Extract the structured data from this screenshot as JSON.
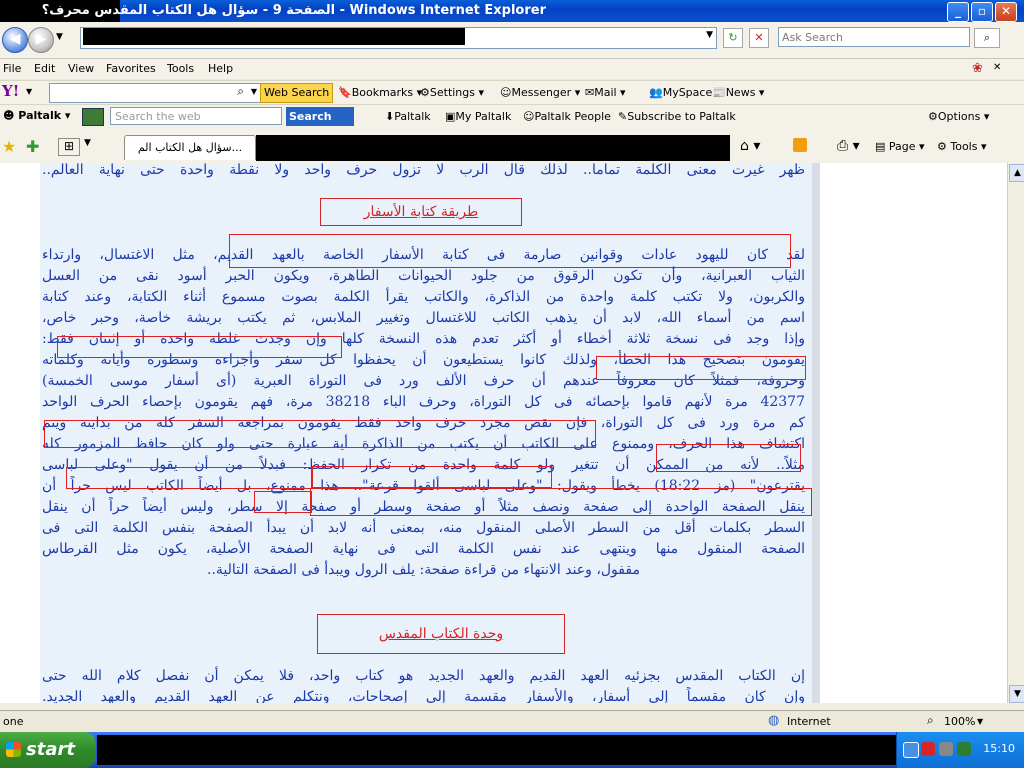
{
  "window": {
    "title": "الصفحة 9 - سؤال هل الكتاب المقدس محرف؟ - Windows Internet Explorer"
  },
  "address_bar": {
    "search_placeholder": "Ask Search"
  },
  "menu_bar": {
    "items": [
      "File",
      "Edit",
      "View",
      "Favorites",
      "Tools",
      "Help"
    ]
  },
  "yahoo_toolbar": {
    "search_button": "Web Search",
    "items": [
      "Bookmarks",
      "Settings",
      "Messenger",
      "Mail",
      "MySpace",
      "News"
    ]
  },
  "paltalk_toolbar": {
    "brand": "Paltalk",
    "search_placeholder": "Search the web",
    "search_button": "Search",
    "items": [
      "Paltalk",
      "My Paltalk",
      "Paltalk People",
      "Subscribe to Paltalk"
    ],
    "options": "Options"
  },
  "tab_bar": {
    "active_tab": "سؤال هل الكتاب الم...",
    "page_menu": "Page",
    "tools_menu": "Tools"
  },
  "content": {
    "top_line": "ظهر غيرت معنى الكلمة تماما.. لذلك قال الرب لا تزول حرف واحد ولا نقطة واحدة حتى نهاية العالم..",
    "heading_1": "طريقة كتابة الأسفار",
    "paragraph_1": [
      "لقد كان لليهود عادات وقوانين صارمة فى كتابة الأسفار الخاصة بالعهد القديم، مثل الاغتسال، وارتداء",
      "الثياب العبرانية، وأن تكون الرقوق من جلود الحيوانات الطاهرة، ويكون الحبر أسود نقى من العسل",
      "والكربون، ولا تكتب كلمة واحدة من الذاكرة، والكاتب يقرأ الكلمة بصوت مسموع أثناء الكتابة، وعند كتابة",
      "اسم من أسماء الله، لابد أن يذهب الكاتب للاغتسال وتغيير الملابس، ثم يكتب بريشة خاصة، وحبر خاص،",
      "وإذا وجد فى نسخة ثلاثة أخطاء أو أكثر تعدم هذه النسخة كلها وإن وجدت غلطة واحدة أو إثنتان فقط:",
      "يقومون بتصحيح هذا الخطأ، ولذلك كانوا يستطيعون أن يحفظوا كل سفر وأجزاءه وسطوره وأياته وكلماته",
      "وحروفه، فمثلاً كان معروفاً عندهم أن حرف الألف ورد فى التوراة العبرية (أى أسفار موسى الخمسة)",
      "42377 مرة لأنهم قاموا بإحصائه فى كل التوراة، وحرف الباء 38218 مرة، فهم يقومون بإحصاء الحرف الواحد",
      "كم مرة ورد فى كل التوراة، فإن نقص مجرد حرف واحد فقط يقومون بمراجعة السفر كله من بدايته ويتم",
      "اكتشاف هذا الحرف، وممنوع على الكاتب أن يكتب من الذاكرة أية عبارة حتى ولو كان حافظ المزمور كله",
      "مثلاً.. لأنه من الممكن أن تتغير ولو كلمة واحدة من تكرار الحفظ: فبدلاً من أن يقول \"وعلى لباسى",
      "يقترعون\" (مز 18:22) يخطأ ويقول: \"وعلى لباسى ألقوا قرعة\".. هذا ممنوع، بل أيضاً الكاتب ليس حراً أن",
      "ينقل الصفحة الواحدة إلى صفحة ونصف مثلاً أو صفحة وسطر أو صفحة إلا سطر، وليس أيضاً حراً أن ينقل",
      "السطر بكلمات أقل من السطر الأصلى المنقول منه، بمعنى أنه لابد أن يبدأ الصفحة بنفس الكلمة التى فى",
      "الصفحة المنقول منها وينتهى عند نفس الكلمة التى فى نهاية الصفحة الأصلية، يكون مثل القرطاس",
      "مقفول، وعند الانتهاء من قراءة صفحة: يلف الرول ويبدأ فى الصفحة التالية.."
    ],
    "heading_2": "وحدة الكتاب المقدس",
    "paragraph_2": [
      "إن الكتاب المقدس بجزئيه العهد القديم والعهد الجديد هو كتاب واحد، فلا يمكن أن نفصل كلام الله حتى",
      "وإن كان مقسماً إلى أسفار، والأسفار مقسمة إلى إصحاحات، ونتكلم عن العهد القديم والعهد الجديد."
    ]
  },
  "status_bar": {
    "left_text": "one",
    "zone": "Internet",
    "zoom": "100%"
  },
  "taskbar": {
    "start": "start",
    "clock": "15:10"
  }
}
